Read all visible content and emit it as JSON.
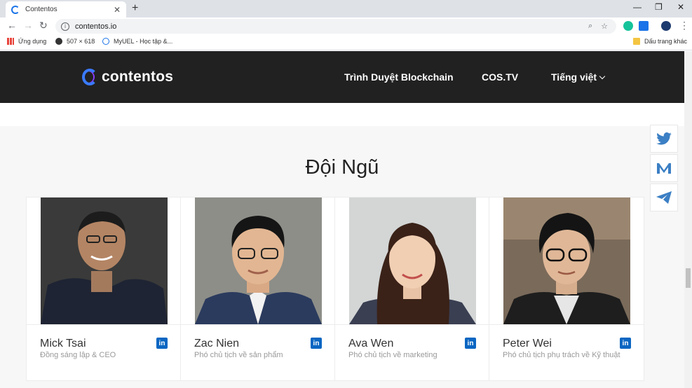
{
  "browser": {
    "tab_title": "Contentos",
    "url": "contentos.io",
    "bookmarks": [
      {
        "label": "Ứng dụng"
      },
      {
        "label": "507 × 618"
      },
      {
        "label": "MyUEL - Học tập &..."
      }
    ],
    "other_bookmarks": "Dấu trang khác"
  },
  "site": {
    "brand": "contentos",
    "nav": [
      {
        "label": "Trình Duyệt Blockchain"
      },
      {
        "label": "COS.TV"
      },
      {
        "label": "Tiếng việt"
      }
    ],
    "section_title": "Đội Ngũ",
    "team": [
      {
        "name": "Mick Tsai",
        "role": "Đồng sáng lập & CEO"
      },
      {
        "name": "Zac Nien",
        "role": "Phó chủ tịch về sản phẩm"
      },
      {
        "name": "Ava Wen",
        "role": "Phó chủ tịch về marketing"
      },
      {
        "name": "Peter Wei",
        "role": "Phó chủ tịch phụ trách về Kỹ thuật"
      }
    ],
    "linkedin_glyph": "in",
    "social_icons": [
      "twitter-icon",
      "medium-icon",
      "telegram-icon"
    ]
  },
  "colors": {
    "header_bg": "#212121",
    "accent_blue": "#3a7bff",
    "linkedin": "#0a66c2",
    "social_icon": "#3b7fc4"
  }
}
